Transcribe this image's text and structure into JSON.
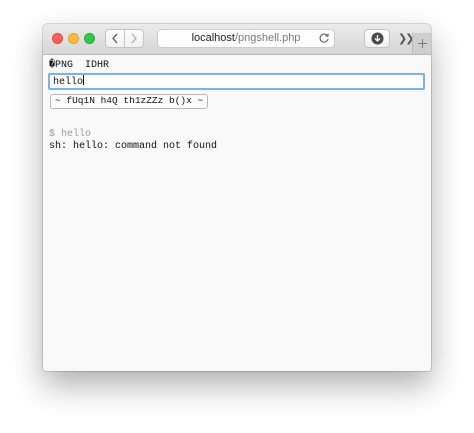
{
  "toolbar": {
    "url_host": "localhost",
    "url_path": "/pngshell.php"
  },
  "page": {
    "png_header": "�PNG  IDHR",
    "input_value": "hello",
    "submit_label": "~ fUq1N h4Q th1zZZz b()x ~",
    "prompt_line": "$ hello",
    "output_line": "sh: hello: command not found"
  },
  "icons": {
    "back": "chevron-left-icon",
    "forward": "chevron-right-icon",
    "reload": "reload-icon",
    "download": "download-icon",
    "more": "double-chevron-icon",
    "new_tab": "plus-icon"
  }
}
